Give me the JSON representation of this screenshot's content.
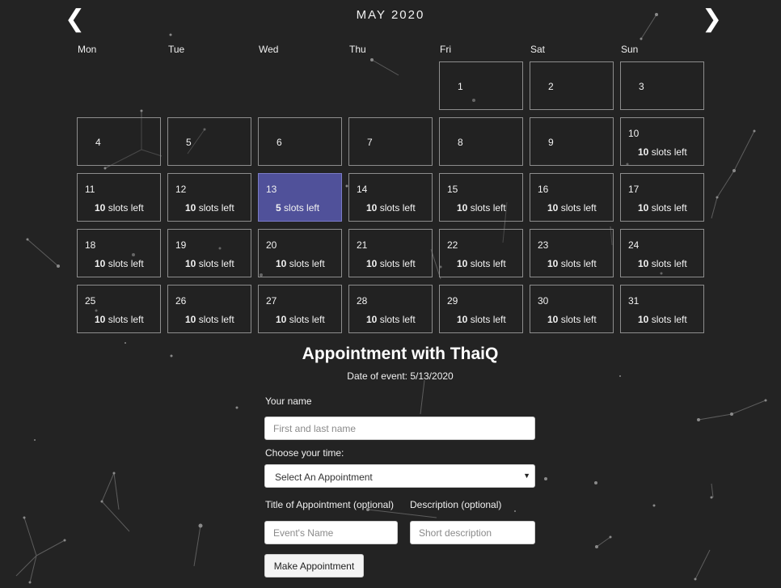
{
  "calendar": {
    "month_title": "MAY 2020",
    "prev_icon": "❮",
    "next_icon": "❯",
    "weekdays": [
      "Mon",
      "Tue",
      "Wed",
      "Thu",
      "Fri",
      "Sat",
      "Sun"
    ],
    "leading_blanks": 4,
    "selected_day": 13,
    "days": [
      {
        "num": "1"
      },
      {
        "num": "2"
      },
      {
        "num": "3"
      },
      {
        "num": "4"
      },
      {
        "num": "5"
      },
      {
        "num": "6"
      },
      {
        "num": "7"
      },
      {
        "num": "8"
      },
      {
        "num": "9"
      },
      {
        "num": "10",
        "slots": "10",
        "slots_text": "slots left"
      },
      {
        "num": "11",
        "slots": "10",
        "slots_text": "slots left"
      },
      {
        "num": "12",
        "slots": "10",
        "slots_text": "slots left"
      },
      {
        "num": "13",
        "slots": "5",
        "slots_text": "slots left"
      },
      {
        "num": "14",
        "slots": "10",
        "slots_text": "slots left"
      },
      {
        "num": "15",
        "slots": "10",
        "slots_text": "slots left"
      },
      {
        "num": "16",
        "slots": "10",
        "slots_text": "slots left"
      },
      {
        "num": "17",
        "slots": "10",
        "slots_text": "slots left"
      },
      {
        "num": "18",
        "slots": "10",
        "slots_text": "slots left"
      },
      {
        "num": "19",
        "slots": "10",
        "slots_text": "slots left"
      },
      {
        "num": "20",
        "slots": "10",
        "slots_text": "slots left"
      },
      {
        "num": "21",
        "slots": "10",
        "slots_text": "slots left"
      },
      {
        "num": "22",
        "slots": "10",
        "slots_text": "slots left"
      },
      {
        "num": "23",
        "slots": "10",
        "slots_text": "slots left"
      },
      {
        "num": "24",
        "slots": "10",
        "slots_text": "slots left"
      },
      {
        "num": "25",
        "slots": "10",
        "slots_text": "slots left"
      },
      {
        "num": "26",
        "slots": "10",
        "slots_text": "slots left"
      },
      {
        "num": "27",
        "slots": "10",
        "slots_text": "slots left"
      },
      {
        "num": "28",
        "slots": "10",
        "slots_text": "slots left"
      },
      {
        "num": "29",
        "slots": "10",
        "slots_text": "slots left"
      },
      {
        "num": "30",
        "slots": "10",
        "slots_text": "slots left"
      },
      {
        "num": "31",
        "slots": "10",
        "slots_text": "slots left"
      }
    ]
  },
  "form": {
    "title": "Appointment with ThaiQ",
    "event_date": "Date of event: 5/13/2020",
    "name_label": "Your name",
    "name_placeholder": "First and last name",
    "name_value": "",
    "time_label": "Choose your time:",
    "time_selected": "Select An Appointment",
    "title_label": "Title of Appointment (optional)",
    "title_placeholder": "Event's Name",
    "desc_label": "Description (optional)",
    "desc_placeholder": "Short description",
    "submit_label": "Make Appointment"
  },
  "colors": {
    "background": "#232323",
    "selected_day": "#50519a",
    "cell_border": "#8d8d8d"
  }
}
